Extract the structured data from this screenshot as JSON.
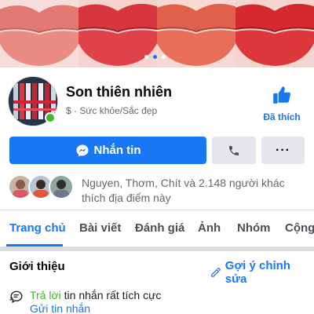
{
  "cover": {
    "tile_colors": [
      "#e8897f",
      "#d8363f",
      "#e0604c",
      "#d42a2e"
    ],
    "active_slide": 1,
    "slide_count": 3
  },
  "page": {
    "name": "Son thiên nhiên",
    "price_symbol": "$",
    "category": "· Sức khỏe/Sắc đẹp",
    "like_label": "Đã thích"
  },
  "actions": {
    "message_label": "Nhắn tin",
    "message_icon": "messenger-icon",
    "call_icon": "phone-icon",
    "more_label": "···"
  },
  "friends": {
    "text": "Nguyen, Thơm, Chít và 2.148 người khác thích địa điểm này"
  },
  "tabs": [
    {
      "label": "Trang chủ",
      "active": true
    },
    {
      "label": "Bài viết",
      "active": false
    },
    {
      "label": "Đánh giá",
      "active": false
    },
    {
      "label": "Ảnh",
      "active": false
    },
    {
      "label": "Nhóm",
      "active": false
    },
    {
      "label": "Cộng",
      "active": false
    }
  ],
  "intro": {
    "title": "Giới thiệu",
    "suggest_edit": "Gợi ý chỉnh sửa",
    "response_highlight": "Trả lời",
    "response_rest": " tin nhắn rất tích cực",
    "send_message": "Gửi tin nhắn"
  },
  "colors": {
    "brand_blue": "#1877f2",
    "online_green": "#42b72a"
  }
}
